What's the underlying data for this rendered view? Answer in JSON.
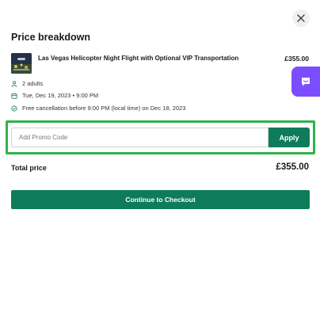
{
  "modal": {
    "title": "Price breakdown",
    "close_icon": "close-icon"
  },
  "product": {
    "name": "Las Vegas Helicopter Night Flight with Optional VIP Transportation",
    "price": "£355.00"
  },
  "details": {
    "travelers": "2 adults",
    "date": "Tue, Dec 19, 2023 • 9:00 PM",
    "cancellation": "Free cancellation before 9:00 PM (local time) on Dec 18, 2023",
    "travelers_icon": "person-icon",
    "date_icon": "calendar-icon",
    "cancellation_icon": "check-circle-icon"
  },
  "promo": {
    "placeholder": "Add Promo Code",
    "apply_label": "Apply"
  },
  "total": {
    "label": "Total price",
    "value": "£355.00"
  },
  "checkout": {
    "label": "Continue to Checkout"
  },
  "chat": {
    "icon": "chat-icon"
  },
  "colors": {
    "brand_green": "#0e7c5a",
    "highlight_green": "#2fb24a",
    "chat_purple": "#7c4dff"
  }
}
